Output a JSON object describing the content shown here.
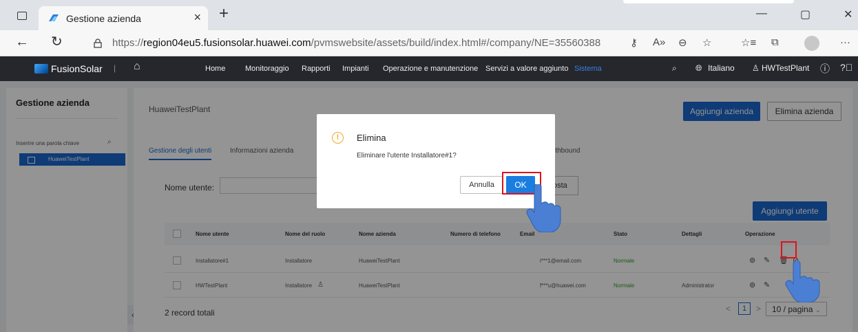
{
  "browser": {
    "tab_title": "Gestione azienda",
    "tab_close": "×",
    "new_tab": "+",
    "url_prefix": "https://",
    "url_domain": "region04eu5.fusionsolar.huawei.com",
    "url_path": "/pvmswebsite/assets/build/index.html#/company/NE=35560388",
    "window_controls": [
      "—",
      "▢",
      "✕"
    ]
  },
  "header": {
    "brand": "FusionSolar",
    "separator": "|",
    "nav": [
      "Home",
      "Monitoraggio",
      "Rapporti",
      "Impianti",
      "Operazione e manutenzione",
      "Servizi a valore aggiunto",
      "Sistema"
    ],
    "active_nav": "Sistema",
    "language": "Italiano",
    "user": "HWTestPlant",
    "icons": [
      "search-icon",
      "globe-icon",
      "user-icon",
      "info-icon",
      "help-icon"
    ]
  },
  "sidebar": {
    "title": "Gestione azienda",
    "search_placeholder": "Inserire una parola chiave",
    "tree": [
      {
        "label": "HuaweiTestPlant",
        "selected": true
      }
    ]
  },
  "content": {
    "breadcrumb": "HuaweiTestPlant",
    "add_company_label": "Aggiungi azienda",
    "delete_company_label": "Elimina azienda",
    "tabs": [
      {
        "label": "Gestione degli utenti",
        "active": true
      },
      {
        "label": "Informazioni azienda",
        "active": false
      },
      {
        "label": "rthbound",
        "active": false
      }
    ],
    "filter_label": "Nome utente:",
    "reset_label": "osta",
    "add_user_label": "Aggiungi utente",
    "table": {
      "columns": [
        "Nome utente",
        "Nome del ruolo",
        "Nome azienda",
        "Numero di telefono",
        "Email",
        "Stato",
        "Dettagli",
        "Operazione"
      ],
      "rows": [
        {
          "user": "Installatore#1",
          "role": "Installatore",
          "company": "HuaweiTestPlant",
          "phone": "",
          "email": "i***1@email.com",
          "status": "Normale",
          "details": ""
        },
        {
          "user": "HWTestPlant",
          "role": "Installatore",
          "company": "HuaweiTestPlant",
          "phone": "",
          "email": "f***u@huawei.com",
          "status": "Normale",
          "details": "Administrator"
        }
      ]
    },
    "total": "2 record totali",
    "pagination": {
      "current": "1",
      "page_size": "10 / pagina",
      "prev": "<",
      "next": ">"
    }
  },
  "dialog": {
    "title": "Elimina",
    "message": "Eliminare l'utente Installatore#1?",
    "cancel_label": "Annulla",
    "ok_label": "OK"
  },
  "colors": {
    "primary": "#1a66cc",
    "header_bg": "#25272c",
    "status_green": "#2e9d2e",
    "warning": "#f5a623",
    "highlight_red": "#e0101a",
    "pointer_blue": "#4a7fd4"
  }
}
